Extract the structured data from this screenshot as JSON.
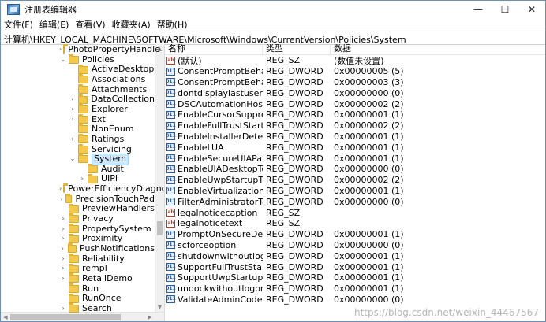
{
  "window": {
    "title": "注册表编辑器",
    "minimize": "—",
    "maximize": "☐",
    "close": "✕"
  },
  "menu": [
    "文件(F)",
    "编辑(E)",
    "查看(V)",
    "收藏夹(A)",
    "帮助(H)"
  ],
  "address": "计算机\\HKEY_LOCAL_MACHINE\\SOFTWARE\\Microsoft\\Windows\\CurrentVersion\\Policies\\System",
  "tree": [
    {
      "label": "PhotoPropertyHandle",
      "level": 1,
      "chev": "›"
    },
    {
      "label": "Policies",
      "level": 1,
      "chev": "⌄"
    },
    {
      "label": "ActiveDesktop",
      "level": 2,
      "chev": ""
    },
    {
      "label": "Associations",
      "level": 2,
      "chev": ""
    },
    {
      "label": "Attachments",
      "level": 2,
      "chev": ""
    },
    {
      "label": "DataCollection",
      "level": 2,
      "chev": "›"
    },
    {
      "label": "Explorer",
      "level": 2,
      "chev": "›"
    },
    {
      "label": "Ext",
      "level": 2,
      "chev": "›"
    },
    {
      "label": "NonEnum",
      "level": 2,
      "chev": ""
    },
    {
      "label": "Ratings",
      "level": 2,
      "chev": "›"
    },
    {
      "label": "Servicing",
      "level": 2,
      "chev": ""
    },
    {
      "label": "System",
      "level": 2,
      "chev": "⌄",
      "selected": true
    },
    {
      "label": "Audit",
      "level": 3,
      "chev": ""
    },
    {
      "label": "UIPI",
      "level": 3,
      "chev": "›"
    },
    {
      "label": "PowerEfficiencyDiagnc",
      "level": 1,
      "chev": "›"
    },
    {
      "label": "PrecisionTouchPad",
      "level": 1,
      "chev": "›"
    },
    {
      "label": "PreviewHandlers",
      "level": 1,
      "chev": ""
    },
    {
      "label": "Privacy",
      "level": 1,
      "chev": "›"
    },
    {
      "label": "PropertySystem",
      "level": 1,
      "chev": "›"
    },
    {
      "label": "Proximity",
      "level": 1,
      "chev": "›"
    },
    {
      "label": "PushNotifications",
      "level": 1,
      "chev": "›"
    },
    {
      "label": "Reliability",
      "level": 1,
      "chev": "›"
    },
    {
      "label": "rempl",
      "level": 1,
      "chev": "›"
    },
    {
      "label": "RetailDemo",
      "level": 1,
      "chev": "›"
    },
    {
      "label": "Run",
      "level": 1,
      "chev": ""
    },
    {
      "label": "RunOnce",
      "level": 1,
      "chev": ""
    },
    {
      "label": "Search",
      "level": 1,
      "chev": "›"
    }
  ],
  "columns": {
    "name": "名称",
    "type": "类型",
    "data": "数据"
  },
  "values": [
    {
      "name": "(默认)",
      "type": "REG_SZ",
      "data": "(数值未设置)",
      "kind": "sz"
    },
    {
      "name": "ConsentPromptBehaviorAdmin",
      "type": "REG_DWORD",
      "data": "0x00000005 (5)",
      "kind": "dw"
    },
    {
      "name": "ConsentPromptBehaviorUser",
      "type": "REG_DWORD",
      "data": "0x00000003 (3)",
      "kind": "dw"
    },
    {
      "name": "dontdisplaylastusername",
      "type": "REG_DWORD",
      "data": "0x00000000 (0)",
      "kind": "dw"
    },
    {
      "name": "DSCAutomationHostEnabled",
      "type": "REG_DWORD",
      "data": "0x00000002 (2)",
      "kind": "dw"
    },
    {
      "name": "EnableCursorSuppression",
      "type": "REG_DWORD",
      "data": "0x00000001 (1)",
      "kind": "dw"
    },
    {
      "name": "EnableFullTrustStartupTasks",
      "type": "REG_DWORD",
      "data": "0x00000002 (2)",
      "kind": "dw"
    },
    {
      "name": "EnableInstallerDetection",
      "type": "REG_DWORD",
      "data": "0x00000001 (1)",
      "kind": "dw"
    },
    {
      "name": "EnableLUA",
      "type": "REG_DWORD",
      "data": "0x00000001 (1)",
      "kind": "dw"
    },
    {
      "name": "EnableSecureUIAPaths",
      "type": "REG_DWORD",
      "data": "0x00000001 (1)",
      "kind": "dw"
    },
    {
      "name": "EnableUIADesktopToggle",
      "type": "REG_DWORD",
      "data": "0x00000000 (0)",
      "kind": "dw"
    },
    {
      "name": "EnableUwpStartupTasks",
      "type": "REG_DWORD",
      "data": "0x00000002 (2)",
      "kind": "dw"
    },
    {
      "name": "EnableVirtualization",
      "type": "REG_DWORD",
      "data": "0x00000001 (1)",
      "kind": "dw"
    },
    {
      "name": "FilterAdministratorToken",
      "type": "REG_DWORD",
      "data": "0x00000000 (0)",
      "kind": "dw"
    },
    {
      "name": "legalnoticecaption",
      "type": "REG_SZ",
      "data": "",
      "kind": "sz"
    },
    {
      "name": "legalnoticetext",
      "type": "REG_SZ",
      "data": "",
      "kind": "sz"
    },
    {
      "name": "PromptOnSecureDesktop",
      "type": "REG_DWORD",
      "data": "0x00000001 (1)",
      "kind": "dw"
    },
    {
      "name": "scforceoption",
      "type": "REG_DWORD",
      "data": "0x00000000 (0)",
      "kind": "dw"
    },
    {
      "name": "shutdownwithoutlogon",
      "type": "REG_DWORD",
      "data": "0x00000001 (1)",
      "kind": "dw"
    },
    {
      "name": "SupportFullTrustStartupTasks",
      "type": "REG_DWORD",
      "data": "0x00000001 (1)",
      "kind": "dw"
    },
    {
      "name": "SupportUwpStartupTasks",
      "type": "REG_DWORD",
      "data": "0x00000001 (1)",
      "kind": "dw"
    },
    {
      "name": "undockwithoutlogon",
      "type": "REG_DWORD",
      "data": "0x00000001 (1)",
      "kind": "dw"
    },
    {
      "name": "ValidateAdminCodeSignatures",
      "type": "REG_DWORD",
      "data": "0x00000000 (0)",
      "kind": "dw"
    }
  ],
  "icon_glyphs": {
    "sz": "ab",
    "dw": "011"
  },
  "watermark": "https://blog.csdn.net/weixin_44467567"
}
